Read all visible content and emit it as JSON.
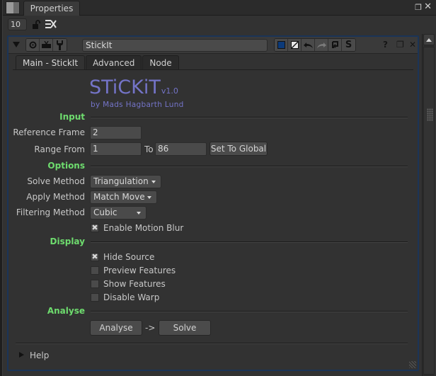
{
  "pane": {
    "tab_label": "Properties",
    "max_panels_value": "10",
    "float_icon": "float-window-icon",
    "close_icon": "close-icon"
  },
  "node": {
    "name": "StickIt",
    "header_icons": [
      "collapse-triangle-icon",
      "viewer-node-icon",
      "tv-icon",
      "wrench-icon",
      "node-color-icon",
      "gl-color-icon",
      "undo-icon",
      "redo-icon",
      "revert-icon",
      "presets-icon",
      "help-icon",
      "float-icon",
      "close-icon"
    ],
    "tile_color": "#0b3a7a",
    "tabs": [
      {
        "label": "Main - StickIt",
        "active": true
      },
      {
        "label": "Advanced",
        "active": false
      },
      {
        "label": "Node",
        "active": false
      }
    ]
  },
  "logo": {
    "title": "STiCKiT",
    "version": "v1.0",
    "author": "by Mads Hagbarth Lund",
    "color": "#7474c8"
  },
  "sections": {
    "input": "Input",
    "options": "Options",
    "display": "Display",
    "analyse": "Analyse",
    "color": "#6edc6e"
  },
  "input": {
    "reference_frame_label": "Reference Frame",
    "reference_frame_value": "2",
    "range_from_label": "Range From",
    "range_from_value": "1",
    "range_to_label": "To",
    "range_to_value": "86",
    "set_to_global_label": "Set To Global"
  },
  "options": {
    "solve_method_label": "Solve Method",
    "solve_method_value": "Triangulation",
    "apply_method_label": "Apply Method",
    "apply_method_value": "Match Move",
    "filtering_method_label": "Filtering Method",
    "filtering_method_value": "Cubic",
    "motion_blur_label": "Enable Motion Blur",
    "motion_blur_checked": true
  },
  "display": {
    "items": [
      {
        "label": "Hide Source",
        "checked": true
      },
      {
        "label": "Preview Features",
        "checked": false
      },
      {
        "label": "Show Features",
        "checked": false
      },
      {
        "label": "Disable Warp",
        "checked": false
      }
    ]
  },
  "analyse": {
    "analyse_label": "Analyse",
    "arrow": "->",
    "solve_label": "Solve"
  },
  "help": {
    "label": "Help"
  }
}
